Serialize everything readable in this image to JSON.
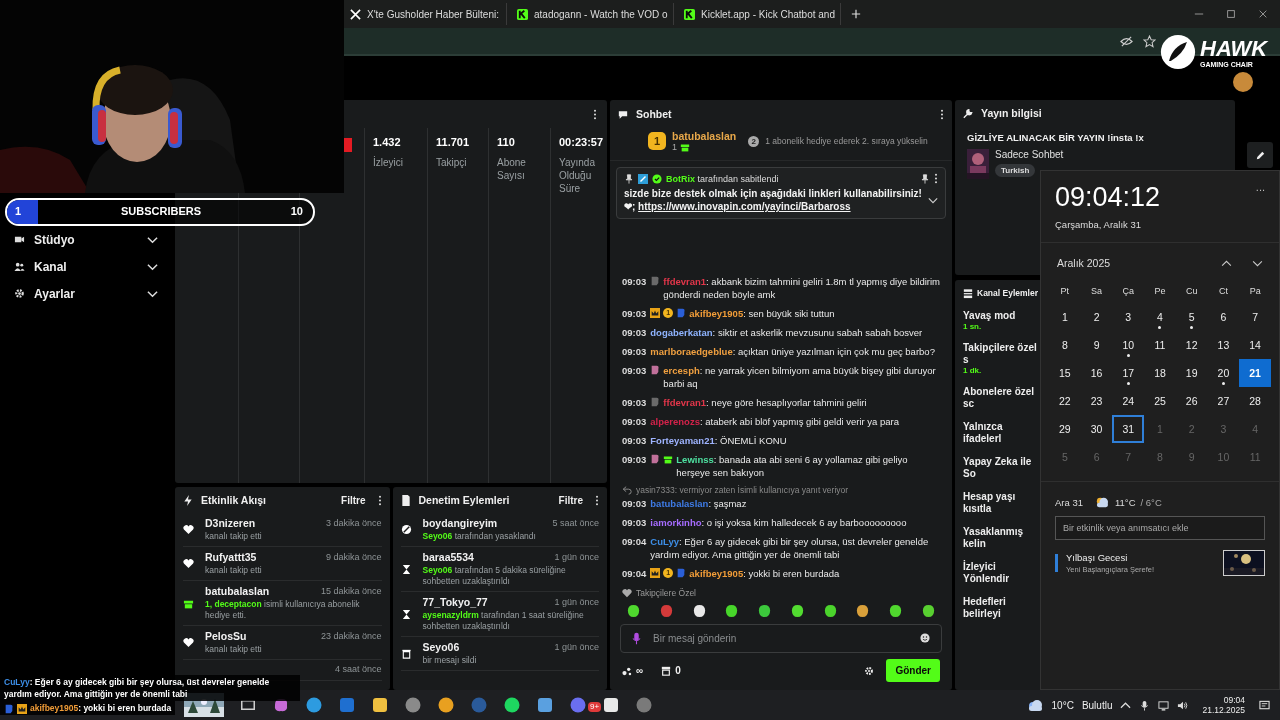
{
  "browser": {
    "tabs": [
      {
        "title": "X'te Gusholder Haber Bülteni:",
        "selected": false
      },
      {
        "title": "atadogann - Watch the VOD o",
        "selected": false
      },
      {
        "title": "Kicklet.app - Kick Chatbot and",
        "selected": false
      }
    ]
  },
  "overlay_logo": {
    "brand": "HAWK",
    "tagline": "GAMING CHAIR"
  },
  "sidebar": {
    "items": [
      {
        "label": "Stüdyo",
        "expandable": true
      },
      {
        "label": "Kanal",
        "expandable": true
      },
      {
        "label": "Ayarlar",
        "expandable": true
      }
    ]
  },
  "stats": {
    "columns": [
      {
        "kind": "blank"
      },
      {
        "kind": "blank"
      },
      {
        "kind": "live"
      },
      {
        "kind": "stat",
        "value": "1.432",
        "label": "İzleyici"
      },
      {
        "kind": "stat",
        "value": "11.701",
        "label": "Takipçi"
      },
      {
        "kind": "stat",
        "value": "110",
        "label": "Abone Sayısı"
      },
      {
        "kind": "stat",
        "value": "00:23:57",
        "label": "Yayında Olduğu Süre"
      }
    ]
  },
  "subscriber_goal": {
    "current": "1",
    "label": "SUBSCRIBERS",
    "target": "10",
    "level": 0.1
  },
  "activity": {
    "title": "Etkinlik Akışı",
    "filter": "Filtre",
    "items": [
      {
        "kind": "follow",
        "name": "D3nizeren",
        "time": "3 dakika önce",
        "text": "kanalı takip etti"
      },
      {
        "kind": "follow",
        "name": "Rufyattt35",
        "time": "9 dakika önce",
        "text": "kanalı takip etti"
      },
      {
        "kind": "gift",
        "name": "batubalaslan",
        "time": "15 dakika önce",
        "highlight": "1, deceptacon",
        "text": "isimli kullanıcıya abonelik hediye etti."
      },
      {
        "kind": "follow",
        "name": "PelosSu",
        "time": "23 dakika önce",
        "text": "kanalı takip etti"
      },
      {
        "kind": "hidden",
        "time": "4 saat önce"
      }
    ]
  },
  "moderation": {
    "title": "Denetim Eylemleri",
    "filter": "Filtre",
    "items": [
      {
        "kind": "ban",
        "name": "boydangireyim",
        "time": "5 saat önce",
        "highlight": "Seyo06",
        "text": "tarafından yasaklandı"
      },
      {
        "kind": "timeout",
        "name": "baraa5534",
        "time": "1 gün önce",
        "highlight": "Seyo06",
        "text": "tarafından 5 dakika süreliğine sohbetten uzaklaştırıldı"
      },
      {
        "kind": "timeout",
        "name": "77_Tokyo_77",
        "time": "1 gün önce",
        "highlight": "aysenazyldrm",
        "text": "tarafından 1 saat süreliğine sohbetten uzaklaştırıldı"
      },
      {
        "kind": "delete",
        "name": "Seyo06",
        "time": "1 gün önce",
        "text": "bir mesajı sildi"
      }
    ]
  },
  "chat": {
    "title": "Sohbet",
    "leader": {
      "rank": "1",
      "name": "batubalaslan",
      "count": "1",
      "next_rank": "2",
      "hint": "1 abonelik hediye ederek 2. sıraya yükselin"
    },
    "pinned": {
      "author": "BotRix",
      "by": "tarafından sabitlendi",
      "text": "sizde bize destek olmak için aşağıdaki linkleri kullanabilirsiniz! ❤;",
      "link": "https://www.inovapin.com/yayinci/Barbaross"
    },
    "messages": [
      {
        "time": "09:03",
        "badges": [
          {
            "kind": "bot"
          }
        ],
        "user": "ffdevran1",
        "color": "#e2364a",
        "text": ": akbank bizim tahmini geliri 1.8m tl yapmış diye bildirim gönderdi neden böyle amk"
      },
      {
        "time": "09:03",
        "badges": [
          {
            "kind": "crown"
          },
          {
            "kind": "coin",
            "label": "1"
          },
          {
            "kind": "b"
          }
        ],
        "user": "akifbey1905",
        "color": "#f29d38",
        "text": ": sen büyük siki tuttun"
      },
      {
        "time": "09:03",
        "user": "dogaberkatan",
        "color": "#8fb4ff",
        "text": ": siktir et askerlik mevzusunu sabah sabah bosver"
      },
      {
        "time": "09:03",
        "user": "marlboraedgeblue",
        "color": "#f0a040",
        "text": ": açıktan üniye yazılman için çok mu geç barbo?"
      },
      {
        "time": "09:03",
        "badges": [
          {
            "kind": "pink"
          }
        ],
        "user": "ercesph",
        "color": "#f0a040",
        "text": ": ne yarrak yicen bilmiyom ama büyük bişey gibi duruyor barbi aq"
      },
      {
        "time": "09:03",
        "badges": [
          {
            "kind": "bot"
          }
        ],
        "user": "ffdevran1",
        "color": "#e2364a",
        "text": ": neye göre hesaplıyorlar tahmini geliri"
      },
      {
        "time": "09:03",
        "user": "alperenozs",
        "color": "#d4224a",
        "text": ": ataberk abi blöf yapmış gibi geldi verir ya para"
      },
      {
        "time": "09:03",
        "user": "Forteyaman21",
        "color": "#9fb4ff",
        "text": ": ÖNEMLİ KONU"
      },
      {
        "time": "09:03",
        "badges": [
          {
            "kind": "pink"
          },
          {
            "kind": "gift"
          }
        ],
        "user": "Lewinss",
        "color": "#4ee0a0",
        "text": ": banada ata abi seni 6 ay yollamaz gibi geliyo herşeye sen bakıyon"
      },
      {
        "time": "09:03",
        "reply": "yasin7333: vermiyor zaten İsimli kullanıcıya yanıt veriyor",
        "user": "batubalaslan",
        "color": "#3e7be6",
        "text": ": şaşmaz"
      },
      {
        "time": "09:03",
        "user": "iamorkinho",
        "color": "#a66cff",
        "text": ": o işi yoksa kim halledecek 6 ay barbooooooooo"
      },
      {
        "time": "09:04",
        "user": "CuLyy",
        "color": "#3d8fe8",
        "text": ": Eğer 6 ay gidecek gibi bir şey olursa, üst devreler genelde yardım ediyor. Ama gittiğin yer de önemli tabi"
      },
      {
        "time": "09:04",
        "badges": [
          {
            "kind": "crown"
          },
          {
            "kind": "coin",
            "label": "1"
          },
          {
            "kind": "b"
          }
        ],
        "user": "akifbey1905",
        "color": "#f29d38",
        "text": ": yokki bi eren burdada"
      }
    ],
    "emotes_label": "Takipçilere Özel",
    "emotes": [
      {
        "color": "#4fd82e"
      },
      {
        "color": "#d43a3a"
      },
      {
        "color": "#e8e8e8"
      },
      {
        "color": "#47d62a"
      },
      {
        "color": "#3cc83c"
      },
      {
        "color": "#52dc30"
      },
      {
        "color": "#4bd42c"
      },
      {
        "color": "#d9a03a"
      },
      {
        "color": "#50d82e"
      },
      {
        "color": "#58d030"
      }
    ],
    "placeholder": "Bir mesaj gönderin",
    "points": "∞",
    "drops": "0",
    "send": "Gönder"
  },
  "stream_info": {
    "title": "Yayın bilgisi",
    "stream_title": "GİZLİYE ALINACAK BİR YAYIN !insta !x",
    "category": "Sadece Sohbet",
    "tags": [
      "Turkish"
    ]
  },
  "channel_actions": {
    "title": "Kanal Eylemler",
    "items": [
      {
        "label": "Yavaş mod",
        "value": "1 sn."
      },
      {
        "label": "Takipçilere özel s",
        "value": "1 dk."
      },
      {
        "label": "Abonelere özel sc"
      },
      {
        "label": "Yalnızca ifadelerl"
      },
      {
        "label": "Yapay Zeka ile So"
      },
      {
        "label": "Hesap yaşı kısıtla"
      },
      {
        "label": "Yasaklanmış kelin"
      },
      {
        "label": "İzleyici Yönlendir"
      },
      {
        "label": "Hedefleri belirleyi"
      }
    ]
  },
  "clock": {
    "time": "09:04:12",
    "date": "Çarşamba, Aralık 31",
    "more": "...",
    "month": "Aralık 2025",
    "weekdays": [
      "Pt",
      "Sa",
      "Ça",
      "Pe",
      "Cu",
      "Ct",
      "Pa"
    ],
    "weeks": [
      [
        {
          "label": "1",
          "dot": false,
          "muted": false,
          "today": false,
          "selected": false
        },
        {
          "label": "2",
          "dot": false,
          "muted": false,
          "today": false,
          "selected": false
        },
        {
          "label": "3",
          "dot": false,
          "muted": false,
          "today": false,
          "selected": false
        },
        {
          "label": "4",
          "dot": true,
          "muted": false,
          "today": false,
          "selected": false
        },
        {
          "label": "5",
          "dot": true,
          "muted": false,
          "today": false,
          "selected": false
        },
        {
          "label": "6",
          "dot": false,
          "muted": false,
          "today": false,
          "selected": false
        },
        {
          "label": "7",
          "dot": false,
          "muted": false,
          "today": false,
          "selected": false
        }
      ],
      [
        {
          "label": "8",
          "dot": false,
          "muted": false,
          "today": false,
          "selected": false
        },
        {
          "label": "9",
          "dot": false,
          "muted": false,
          "today": false,
          "selected": false
        },
        {
          "label": "10",
          "dot": true,
          "muted": false,
          "today": false,
          "selected": false
        },
        {
          "label": "11",
          "dot": false,
          "muted": false,
          "today": false,
          "selected": false
        },
        {
          "label": "12",
          "dot": false,
          "muted": false,
          "today": false,
          "selected": false
        },
        {
          "label": "13",
          "dot": false,
          "muted": false,
          "today": false,
          "selected": false
        },
        {
          "label": "14",
          "dot": false,
          "muted": false,
          "today": false,
          "selected": false
        }
      ],
      [
        {
          "label": "15",
          "dot": false,
          "muted": false,
          "today": false,
          "selected": false
        },
        {
          "label": "16",
          "dot": false,
          "muted": false,
          "today": false,
          "selected": false
        },
        {
          "label": "17",
          "dot": true,
          "muted": false,
          "today": false,
          "selected": false
        },
        {
          "label": "18",
          "dot": false,
          "muted": false,
          "today": false,
          "selected": false
        },
        {
          "label": "19",
          "dot": false,
          "muted": false,
          "today": false,
          "selected": false
        },
        {
          "label": "20",
          "dot": true,
          "muted": false,
          "today": false,
          "selected": false
        },
        {
          "label": "21",
          "dot": false,
          "muted": false,
          "today": true,
          "selected": false
        }
      ],
      [
        {
          "label": "22",
          "dot": false,
          "muted": false,
          "today": false,
          "selected": false
        },
        {
          "label": "23",
          "dot": false,
          "muted": false,
          "today": false,
          "selected": false
        },
        {
          "label": "24",
          "dot": false,
          "muted": false,
          "today": false,
          "selected": false
        },
        {
          "label": "25",
          "dot": false,
          "muted": false,
          "today": false,
          "selected": false
        },
        {
          "label": "26",
          "dot": false,
          "muted": false,
          "today": false,
          "selected": false
        },
        {
          "label": "27",
          "dot": false,
          "muted": false,
          "today": false,
          "selected": false
        },
        {
          "label": "28",
          "dot": false,
          "muted": false,
          "today": false,
          "selected": false
        }
      ],
      [
        {
          "label": "29",
          "dot": false,
          "muted": false,
          "today": false,
          "selected": false
        },
        {
          "label": "30",
          "dot": false,
          "muted": false,
          "today": false,
          "selected": false
        },
        {
          "label": "31",
          "dot": false,
          "muted": false,
          "today": false,
          "selected": true
        },
        {
          "label": "1",
          "dot": false,
          "muted": true,
          "today": false,
          "selected": false
        },
        {
          "label": "2",
          "dot": false,
          "muted": true,
          "today": false,
          "selected": false
        },
        {
          "label": "3",
          "dot": false,
          "muted": true,
          "today": false,
          "selected": false
        },
        {
          "label": "4",
          "dot": false,
          "muted": true,
          "today": false,
          "selected": false
        }
      ],
      [
        {
          "label": "5",
          "dot": false,
          "muted": true,
          "today": false,
          "selected": false
        },
        {
          "label": "6",
          "dot": false,
          "muted": true,
          "today": false,
          "selected": false
        },
        {
          "label": "7",
          "dot": false,
          "muted": true,
          "today": false,
          "selected": false
        },
        {
          "label": "8",
          "dot": false,
          "muted": true,
          "today": false,
          "selected": false
        },
        {
          "label": "9",
          "dot": false,
          "muted": true,
          "today": false,
          "selected": false
        },
        {
          "label": "10",
          "dot": false,
          "muted": true,
          "today": false,
          "selected": false
        },
        {
          "label": "11",
          "dot": false,
          "muted": true,
          "today": false,
          "selected": false
        }
      ]
    ],
    "weather_day": "Ara 31",
    "high": "11°C",
    "low": "/ 6°C",
    "event_placeholder": "Bir etkinlik veya anımsatıcı ekle",
    "events": [
      {
        "title": "Yılbaşı Gecesi",
        "subtitle": "Yeni Başlangıçlara Şerefe!",
        "color": "#2f7fd8"
      }
    ]
  },
  "overlay_chat": [
    {
      "user": "CuLyy",
      "color": "#3d8fe8",
      "text": ": Eğer 6 ay gidecek gibi bir şey olursa, üst devreler genelde yardım ediyor. Ama gittiğin yer de önemli tabi"
    },
    {
      "badges": [
        {
          "kind": "b"
        },
        {
          "kind": "crown"
        }
      ],
      "user": "akifbey1905",
      "color": "#f29d38",
      "text": ": yokki bi eren burdada"
    }
  ],
  "taskbar": {
    "apps": [
      {
        "kind": "frame",
        "color": "#cfcfcf"
      },
      {
        "kind": "blob",
        "color": "#c86bd8"
      },
      {
        "kind": "circle",
        "color": "#2d9be0"
      },
      {
        "kind": "square",
        "color": "#1f6fd0"
      },
      {
        "kind": "square",
        "color": "#f0c040"
      },
      {
        "kind": "circle",
        "color": "#8a8a8a"
      },
      {
        "kind": "circle",
        "color": "#e8a020"
      },
      {
        "kind": "circle",
        "color": "#2a5a9a"
      },
      {
        "kind": "circle",
        "color": "#1ed760"
      },
      {
        "kind": "square",
        "color": "#5aa0e0"
      },
      {
        "kind": "circle",
        "color": "#6a6ef0",
        "badge": "9+"
      },
      {
        "kind": "square",
        "color": "#e8e8e8"
      },
      {
        "kind": "circle",
        "color": "#7a7a7a"
      }
    ],
    "temperature": "10°C",
    "weather": "Bulutlu",
    "time": "09:04",
    "date": "21.12.2025"
  }
}
